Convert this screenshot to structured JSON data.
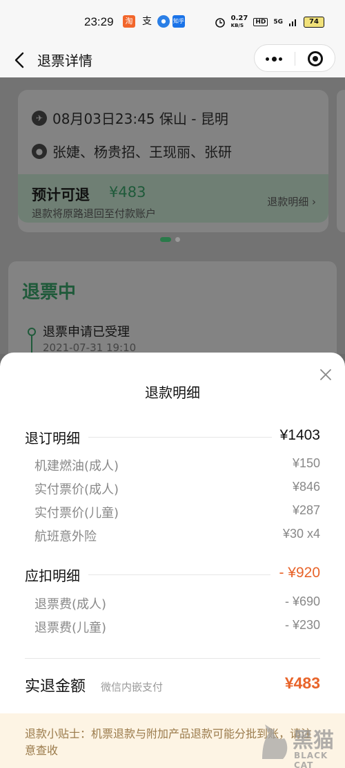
{
  "status_bar": {
    "time": "23:29",
    "network_speed": "0.27",
    "speed_unit": "KB/S",
    "hd": "HD",
    "signal": "5G",
    "battery": "74",
    "app_icons": [
      "淘",
      "支",
      "●",
      "知乎"
    ]
  },
  "nav": {
    "title": "退票详情"
  },
  "flight_card": {
    "route": "08月03日23:45 保山 - 昆明",
    "passengers": "张婕、杨贵招、王现丽、张研",
    "estimate_label": "预计可退",
    "estimate_amount": "¥483",
    "estimate_note": "退款将原路退回至付款账户",
    "detail_link": "退款明细"
  },
  "status_card": {
    "title": "退票中",
    "step_text": "退票申请已受理",
    "step_time": "2021-07-31 19:10"
  },
  "sheet": {
    "title": "退款明细",
    "refund_section": {
      "label": "退订明细",
      "total": "¥1403",
      "items": [
        {
          "name": "机建燃油(成人)",
          "value": "¥150"
        },
        {
          "name": "实付票价(成人)",
          "value": "¥846"
        },
        {
          "name": "实付票价(儿童)",
          "value": "¥287"
        },
        {
          "name": "航班意外险",
          "value": "¥30  x4"
        }
      ]
    },
    "deduct_section": {
      "label": "应扣明细",
      "total": "- ¥920",
      "items": [
        {
          "name": "退票费(成人)",
          "value": "- ¥690"
        },
        {
          "name": "退票费(儿童)",
          "value": "- ¥230"
        }
      ]
    },
    "actual": {
      "label": "实退金额",
      "sub": "微信内嵌支付",
      "value": "¥483"
    },
    "tip": "退款小贴士：机票退款与附加产品退款可能分批到账，请注意查收"
  },
  "watermark": {
    "text": "黑猫",
    "sub": "BLACK CAT"
  },
  "colors": {
    "accent_green": "#1f5a3a",
    "accent_orange": "#e8642a",
    "tip_bg": "#fdf4e4"
  }
}
